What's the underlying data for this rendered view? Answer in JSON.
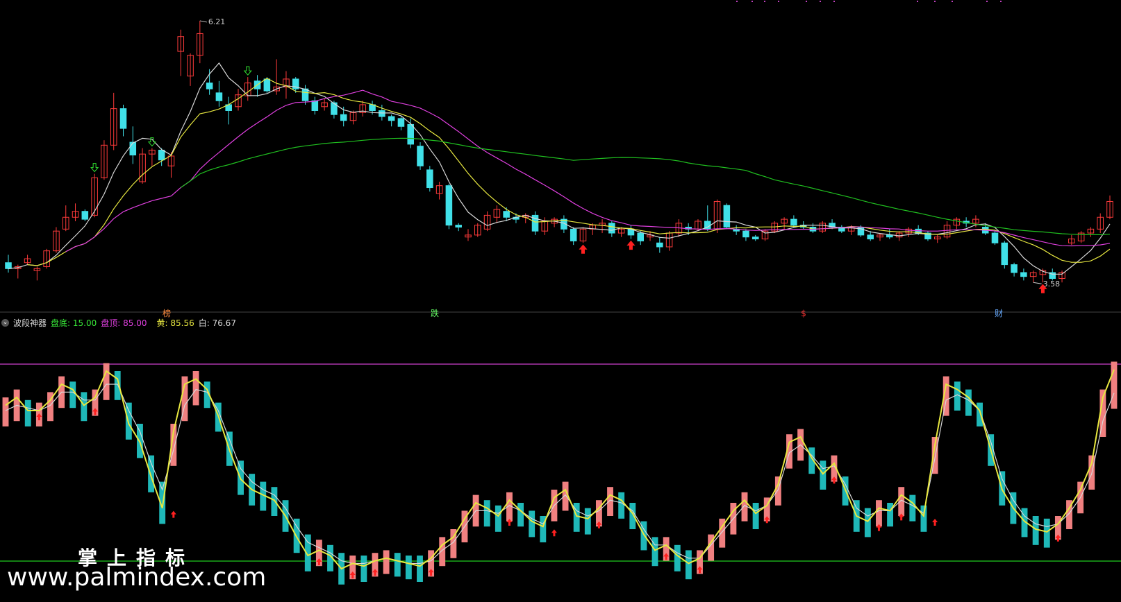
{
  "header": {
    "indicator_name": "波段神器",
    "bottom_label": "盘底:",
    "bottom_value": "15.00",
    "top_label": "盘顶:",
    "top_value": "85.00",
    "yellow_label": "黄:",
    "yellow_value": "85.56",
    "white_label": "白:",
    "white_value": "76.67"
  },
  "price_annotations": {
    "high": "6.21",
    "low": "3.58"
  },
  "event_tags": [
    {
      "text": "榜",
      "color": "#ff8c40"
    },
    {
      "text": "跌",
      "color": "#66ff66"
    },
    {
      "text": "$",
      "color": "#ff3333"
    },
    {
      "text": "财",
      "color": "#66aaff"
    }
  ],
  "watermark": {
    "cn": "掌上指标",
    "url": "www.palmindex.com"
  },
  "colors": {
    "up": "#ff3b3b",
    "down": "#40e0e8",
    "ma_white": "#d8d8d8",
    "ma_yellow": "#e8e840",
    "ma_magenta": "#e040e0",
    "ma_green": "#20c020",
    "osc_up": "#f08080",
    "osc_down": "#1fb8b8"
  },
  "chart_data": [
    {
      "type": "candlestick",
      "title": "",
      "ylim": [
        3.4,
        6.35
      ],
      "series": [
        {
          "name": "",
          "kind": "ohlc",
          "values": [
            [
              3.76,
              3.84,
              3.66,
              3.7
            ],
            [
              3.7,
              3.74,
              3.6,
              3.72
            ],
            [
              3.76,
              3.84,
              3.74,
              3.8
            ],
            [
              3.68,
              3.72,
              3.58,
              3.7
            ],
            [
              3.72,
              3.9,
              3.7,
              3.88
            ],
            [
              3.88,
              4.12,
              3.86,
              4.08
            ],
            [
              4.1,
              4.34,
              4.08,
              4.22
            ],
            [
              4.22,
              4.36,
              4.18,
              4.28
            ],
            [
              4.28,
              4.3,
              4.18,
              4.2
            ],
            [
              4.24,
              4.66,
              4.22,
              4.62
            ],
            [
              4.62,
              5.0,
              4.6,
              4.95
            ],
            [
              4.95,
              5.48,
              4.9,
              5.32
            ],
            [
              5.32,
              5.36,
              5.04,
              5.12
            ],
            [
              4.98,
              5.14,
              4.76,
              4.85
            ],
            [
              4.58,
              4.92,
              4.56,
              4.86
            ],
            [
              4.86,
              4.92,
              4.74,
              4.9
            ],
            [
              4.9,
              4.92,
              4.74,
              4.8
            ],
            [
              4.74,
              4.88,
              4.62,
              4.84
            ],
            [
              5.9,
              6.12,
              5.65,
              6.05
            ],
            [
              5.65,
              5.88,
              5.55,
              5.86
            ],
            [
              5.86,
              6.21,
              5.78,
              6.08
            ],
            [
              5.58,
              5.72,
              5.46,
              5.52
            ],
            [
              5.48,
              5.6,
              5.34,
              5.4
            ],
            [
              5.36,
              5.44,
              5.16,
              5.3
            ],
            [
              5.34,
              5.52,
              5.3,
              5.46
            ],
            [
              5.45,
              5.64,
              5.4,
              5.58
            ],
            [
              5.6,
              5.66,
              5.44,
              5.52
            ],
            [
              5.62,
              5.64,
              5.48,
              5.5
            ],
            [
              5.5,
              5.82,
              5.46,
              5.54
            ],
            [
              5.54,
              5.7,
              5.42,
              5.62
            ],
            [
              5.62,
              5.64,
              5.48,
              5.52
            ],
            [
              5.52,
              5.56,
              5.36,
              5.4
            ],
            [
              5.4,
              5.44,
              5.26,
              5.3
            ],
            [
              5.34,
              5.42,
              5.3,
              5.38
            ],
            [
              5.38,
              5.4,
              5.22,
              5.26
            ],
            [
              5.26,
              5.34,
              5.14,
              5.2
            ],
            [
              5.2,
              5.3,
              5.16,
              5.28
            ],
            [
              5.28,
              5.4,
              5.24,
              5.36
            ],
            [
              5.36,
              5.4,
              5.26,
              5.3
            ],
            [
              5.3,
              5.36,
              5.2,
              5.24
            ],
            [
              5.24,
              5.26,
              5.14,
              5.2
            ],
            [
              5.22,
              5.24,
              5.1,
              5.14
            ],
            [
              5.16,
              5.22,
              4.92,
              4.96
            ],
            [
              4.94,
              4.98,
              4.7,
              4.74
            ],
            [
              4.7,
              4.74,
              4.48,
              4.52
            ],
            [
              4.46,
              4.58,
              4.4,
              4.54
            ],
            [
              4.54,
              4.56,
              4.1,
              4.14
            ],
            [
              4.14,
              4.16,
              4.08,
              4.12
            ],
            [
              4.02,
              4.1,
              3.98,
              4.04
            ],
            [
              4.04,
              4.16,
              4.02,
              4.14
            ],
            [
              4.1,
              4.28,
              4.08,
              4.24
            ],
            [
              4.22,
              4.34,
              4.16,
              4.3
            ],
            [
              4.28,
              4.32,
              4.18,
              4.22
            ],
            [
              4.22,
              4.26,
              4.16,
              4.2
            ],
            [
              4.22,
              4.26,
              4.16,
              4.24
            ],
            [
              4.24,
              4.28,
              4.04,
              4.08
            ],
            [
              4.08,
              4.22,
              4.04,
              4.18
            ],
            [
              4.16,
              4.22,
              4.12,
              4.2
            ],
            [
              4.2,
              4.24,
              4.06,
              4.1
            ],
            [
              4.1,
              4.12,
              3.94,
              3.98
            ],
            [
              3.98,
              4.12,
              3.96,
              4.1
            ],
            [
              4.1,
              4.16,
              4.04,
              4.14
            ],
            [
              4.14,
              4.2,
              4.06,
              4.16
            ],
            [
              4.16,
              4.18,
              4.02,
              4.06
            ],
            [
              4.06,
              4.12,
              4.02,
              4.1
            ],
            [
              4.1,
              4.14,
              4.0,
              4.04
            ],
            [
              4.06,
              4.08,
              3.94,
              3.98
            ],
            [
              4.02,
              4.08,
              3.98,
              4.04
            ],
            [
              3.96,
              4.02,
              3.86,
              3.92
            ],
            [
              3.92,
              4.08,
              3.88,
              4.06
            ],
            [
              4.06,
              4.2,
              4.02,
              4.16
            ],
            [
              4.12,
              4.16,
              4.04,
              4.1
            ],
            [
              4.1,
              4.2,
              4.08,
              4.18
            ],
            [
              4.18,
              4.34,
              4.08,
              4.1
            ],
            [
              4.1,
              4.4,
              4.06,
              4.38
            ],
            [
              4.34,
              4.36,
              4.1,
              4.12
            ],
            [
              4.1,
              4.14,
              4.04,
              4.08
            ],
            [
              4.08,
              4.1,
              3.98,
              4.02
            ],
            [
              4.02,
              4.04,
              3.98,
              4.0
            ],
            [
              4.0,
              4.1,
              3.98,
              4.08
            ],
            [
              4.08,
              4.18,
              4.06,
              4.16
            ],
            [
              4.16,
              4.22,
              4.1,
              4.2
            ],
            [
              4.2,
              4.24,
              4.12,
              4.14
            ],
            [
              4.14,
              4.18,
              4.1,
              4.12
            ],
            [
              4.12,
              4.16,
              4.06,
              4.08
            ],
            [
              4.08,
              4.18,
              4.06,
              4.16
            ],
            [
              4.16,
              4.2,
              4.1,
              4.12
            ],
            [
              4.12,
              4.14,
              4.06,
              4.08
            ],
            [
              4.08,
              4.14,
              4.04,
              4.12
            ],
            [
              4.12,
              4.14,
              4.02,
              4.04
            ],
            [
              4.04,
              4.08,
              3.98,
              4.0
            ],
            [
              4.02,
              4.06,
              3.98,
              4.04
            ],
            [
              4.04,
              4.1,
              4.0,
              4.02
            ],
            [
              4.02,
              4.08,
              3.98,
              4.06
            ],
            [
              4.06,
              4.12,
              4.02,
              4.1
            ],
            [
              4.1,
              4.14,
              4.04,
              4.06
            ],
            [
              4.06,
              4.08,
              3.98,
              4.0
            ],
            [
              4.0,
              4.04,
              3.96,
              4.02
            ],
            [
              4.02,
              4.18,
              4.0,
              4.14
            ],
            [
              4.14,
              4.22,
              4.1,
              4.2
            ],
            [
              4.18,
              4.22,
              4.12,
              4.16
            ],
            [
              4.16,
              4.24,
              4.12,
              4.2
            ],
            [
              4.12,
              4.16,
              4.04,
              4.06
            ],
            [
              4.06,
              4.08,
              3.94,
              3.96
            ],
            [
              3.96,
              3.98,
              3.7,
              3.74
            ],
            [
              3.74,
              3.76,
              3.62,
              3.66
            ],
            [
              3.66,
              3.7,
              3.58,
              3.62
            ],
            [
              3.62,
              3.68,
              3.56,
              3.66
            ],
            [
              3.64,
              3.7,
              3.56,
              3.68
            ],
            [
              3.66,
              3.7,
              3.58,
              3.6
            ],
            [
              3.6,
              3.68,
              3.56,
              3.66
            ],
            [
              3.96,
              4.04,
              3.94,
              4.0
            ],
            [
              3.98,
              4.08,
              3.96,
              4.06
            ],
            [
              4.06,
              4.12,
              4.02,
              4.1
            ],
            [
              4.1,
              4.26,
              4.06,
              4.22
            ],
            [
              4.22,
              4.44,
              4.2,
              4.38
            ]
          ]
        }
      ]
    },
    {
      "type": "line",
      "title": "波段神器",
      "ylim": [
        0,
        100
      ],
      "reference_lines": [
        {
          "name": "盘底",
          "value": 15
        },
        {
          "name": "盘顶",
          "value": 85
        }
      ],
      "series": [
        {
          "name": "黄",
          "values": [
            72,
            75,
            70,
            70,
            74,
            80,
            78,
            72,
            75,
            85,
            82,
            65,
            58,
            45,
            33,
            62,
            80,
            82,
            78,
            68,
            55,
            44,
            40,
            38,
            36,
            30,
            22,
            15,
            17,
            15,
            10,
            12,
            11,
            13,
            14,
            13,
            12,
            11,
            14,
            19,
            22,
            29,
            35,
            33,
            30,
            36,
            32,
            28,
            26,
            37,
            40,
            30,
            29,
            33,
            38,
            36,
            31,
            23,
            17,
            19,
            15,
            12,
            14,
            20,
            26,
            32,
            36,
            31,
            34,
            42,
            58,
            60,
            52,
            46,
            50,
            40,
            30,
            28,
            33,
            32,
            38,
            35,
            30,
            57,
            80,
            78,
            75,
            70,
            55,
            40,
            33,
            28,
            25,
            24,
            27,
            33,
            40,
            50,
            75,
            85.56
          ]
        },
        {
          "name": "白",
          "values": [
            70,
            72,
            71,
            70,
            72,
            77,
            77,
            74,
            74,
            80,
            80,
            70,
            62,
            50,
            40,
            55,
            72,
            78,
            77,
            70,
            59,
            48,
            43,
            40,
            38,
            33,
            26,
            20,
            18,
            16,
            13,
            12,
            12,
            13,
            14,
            13,
            12,
            12,
            13,
            17,
            20,
            26,
            32,
            32,
            31,
            34,
            32,
            29,
            27,
            34,
            38,
            32,
            30,
            32,
            36,
            35,
            32,
            25,
            19,
            19,
            16,
            14,
            14,
            19,
            24,
            29,
            34,
            32,
            34,
            40,
            54,
            57,
            53,
            48,
            49,
            42,
            33,
            30,
            32,
            32,
            36,
            34,
            31,
            52,
            74,
            76,
            74,
            70,
            58,
            44,
            36,
            30,
            27,
            26,
            27,
            31,
            37,
            46,
            66,
            76.67
          ]
        }
      ]
    }
  ]
}
